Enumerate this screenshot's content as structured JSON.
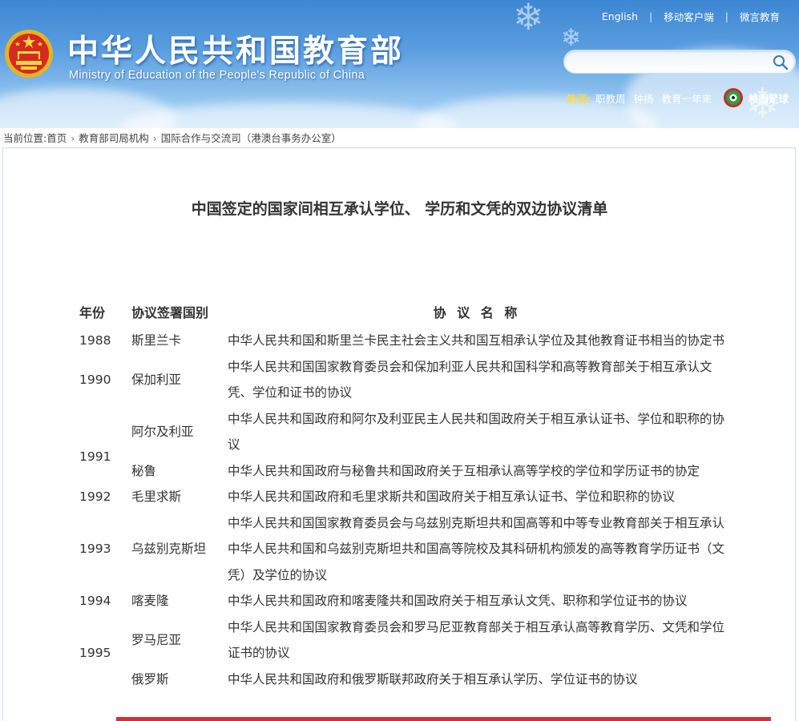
{
  "header": {
    "title": "中华人民共和国教育部",
    "subtitle": "Ministry of Education of the People's Republic of China",
    "top_links": [
      "English",
      "移动客户端",
      "微言教育"
    ],
    "search": {
      "value": "",
      "placeholder": ""
    },
    "hot_label": "热词:",
    "hot_words": [
      "职教周",
      "钟扬",
      "教育一年来"
    ],
    "campus_football": "校园足球"
  },
  "breadcrumb": {
    "prefix": "当前位置:",
    "items": [
      "首页",
      "教育部司局机构",
      "国际合作与交流司（港澳台事务办公室）"
    ]
  },
  "document": {
    "title": "中国签定的国家间相互承认学位、 学历和文凭的双边协议清单",
    "columns": [
      "年份",
      "协议签署国别",
      "协 议 名 称"
    ],
    "rows": [
      {
        "year": "1988",
        "country": "斯里兰卡",
        "name": "中华人民共和国和斯里兰卡民主社会主义共和国互相承认学位及其他教育证书相当的协定书"
      },
      {
        "year": "1990",
        "country": "保加利亚",
        "name": "中华人民共和国国家教育委员会和保加利亚人民共和国科学和高等教育部关于相互承认文凭、学位和证书的协议"
      },
      {
        "year": "1991",
        "country": "阿尔及利亚",
        "name": "中华人民共和国政府和阿尔及利亚民主人民共和国政府关于相互承认证书、学位和职称的协议"
      },
      {
        "year": "",
        "country": "秘鲁",
        "name": "中华人民共和国政府与秘鲁共和国政府关于互相承认高等学校的学位和学历证书的协定"
      },
      {
        "year": "1992",
        "country": "毛里求斯",
        "name": "中华人民共和国政府和毛里求斯共和国政府关于相互承认证书、学位和职称的协议"
      },
      {
        "year": "1993",
        "country": "乌兹别克斯坦",
        "name": "中华人民共和国国家教育委员会与乌兹别克斯坦共和国高等和中等专业教育部关于相互承认中华人民共和国和乌兹别克斯坦共和国高等院校及其科研机构颁发的高等教育学历证书（文凭）及学位的协议"
      },
      {
        "year": "1994",
        "country": "喀麦隆",
        "name": "中华人民共和国政府和喀麦隆共和国政府关于相互承认文凭、职称和学位证书的协议"
      },
      {
        "year": "1995",
        "country": "罗马尼亚",
        "name": "中华人民共和国国家教育委员会和罗马尼亚教育部关于相互承认高等教育学历、文凭和学位证书的协议"
      },
      {
        "year": "",
        "country": "俄罗斯",
        "name": "中华人民共和国政府和俄罗斯联邦政府关于相互承认学历、学位证书的协议"
      }
    ]
  }
}
